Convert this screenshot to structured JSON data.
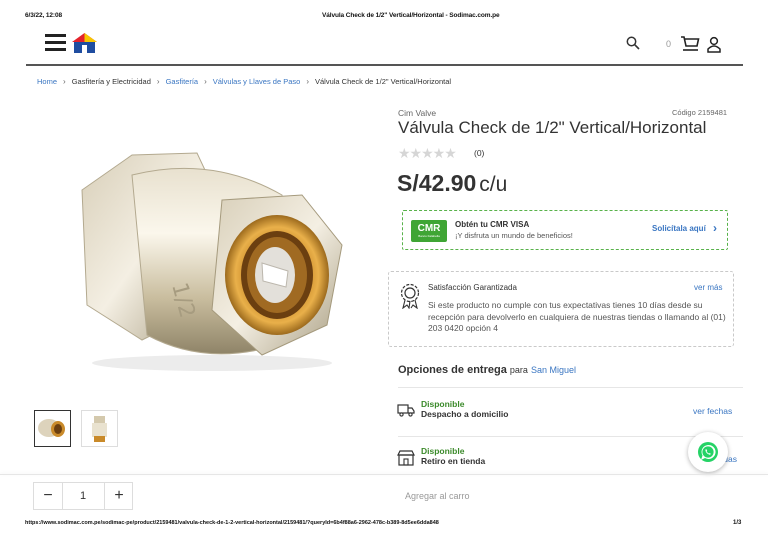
{
  "print_header": {
    "datetime": "6/3/22, 12:08",
    "doc_title": "Válvula Check de 1/2\" Vertical/Horizontal - Sodimac.com.pe"
  },
  "header": {
    "cart_count": "0"
  },
  "breadcrumb": [
    "Home",
    "Gasfitería y Electricidad",
    "Gasfitería",
    "Válvulas y Llaves de Paso",
    "Válvula Check de 1/2\" Vertical/Horizontal"
  ],
  "product": {
    "brand": "Cim Valve",
    "code": "Código 2159481",
    "title": "Válvula Check de 1/2\" Vertical/Horizontal",
    "rating_stars": "★★★★★",
    "rating_value": 0,
    "review_count": "(0)",
    "price": "S/42.90",
    "unit": "c/u"
  },
  "cmr": {
    "logo": "CMR",
    "logo_sub": "Banco Falabella",
    "title": "Obtén tu CMR VISA",
    "subtitle": "¡Y disfruta un mundo de beneficios!",
    "cta": "Solicítala aquí"
  },
  "satisfaction": {
    "title": "Satisfacción Garantizada",
    "link": "ver más",
    "text": "Si este producto no cumple con tus expectativas tienes 10 días desde su recepción para devolverlo en cualquiera de nuestras tiendas o llamando al (01) 203 0420 opción 4"
  },
  "delivery": {
    "heading": "Opciones de entrega",
    "para": "para",
    "location": "San Miguel",
    "options": [
      {
        "status": "Disponible",
        "label": "Despacho a domicilio",
        "link": "ver fechas"
      },
      {
        "status": "Disponible",
        "label": "Retiro en tienda",
        "link": "ver tiendas"
      }
    ]
  },
  "cart_bar": {
    "minus": "−",
    "qty": "1",
    "plus": "+",
    "add_label": "Agregar al carro"
  },
  "footer": {
    "url": "https://www.sodimac.com.pe/sodimac-pe/product/2159481/valvula-check-de-1-2-vertical-horizontal/2159481/?queryId=6b4f88a6-2962-478c-b389-8d5ee6dda848",
    "page": "1/3"
  },
  "colors": {
    "brand_blue": "#3a76c2",
    "green": "#3b8a2a",
    "cmr_green": "#58b24a",
    "whatsapp": "#25d366"
  }
}
